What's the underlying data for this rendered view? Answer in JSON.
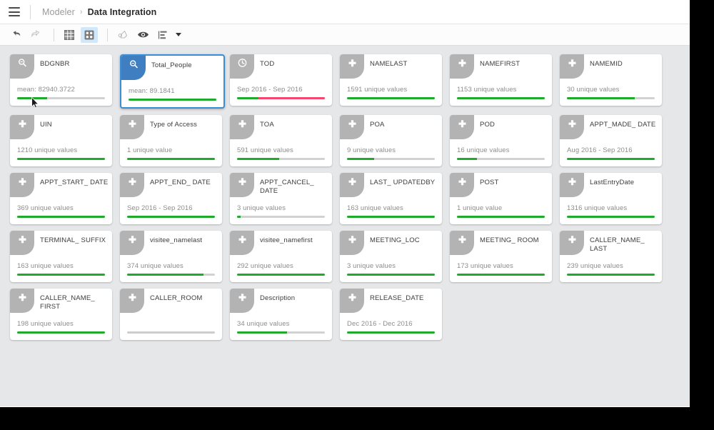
{
  "header": {
    "menu_icon": "hamburger-menu-icon",
    "breadcrumb": {
      "root": "Modeler",
      "separator": "›",
      "current": "Data Integration"
    }
  },
  "toolbar": {
    "buttons": [
      {
        "name": "undo-button",
        "icon": "undo-arrow-icon",
        "label": "Undo",
        "active": false
      },
      {
        "name": "redo-button",
        "icon": "redo-arrow-icon",
        "label": "Redo",
        "active": false
      },
      {
        "name": "table-view-button",
        "icon": "table-grid-icon",
        "label": "Table view",
        "active": false
      },
      {
        "name": "card-view-button",
        "icon": "card-grid-icon",
        "label": "Card view",
        "active": true
      },
      {
        "name": "paint-button",
        "icon": "paint-roller-icon",
        "label": "Paint",
        "active": false
      },
      {
        "name": "preview-button",
        "icon": "eye-icon",
        "label": "Preview",
        "active": false
      },
      {
        "name": "sort-button",
        "icon": "sort-list-icon",
        "label": "Sort",
        "active": false
      }
    ],
    "dropdown_caret": "chevron-down-icon"
  },
  "canvas": {
    "cards": [
      {
        "title": "BDGNBR",
        "type": "continuous",
        "icon": "ruler-icon",
        "stat": "mean: 82940.3722",
        "bar": [
          {
            "color": "#1faa2b",
            "pct": 34
          }
        ],
        "selected": false
      },
      {
        "title": "Total_People",
        "type": "continuous",
        "icon": "ruler-icon",
        "stat": "mean: 89.1841",
        "bar": [
          {
            "color": "#1faa2b",
            "pct": 100
          }
        ],
        "selected": true
      },
      {
        "title": "TOD",
        "type": "datetime",
        "icon": "clock-icon",
        "stat": "Sep 2016 - Sep 2016",
        "bar": [
          {
            "color": "#1faa2b",
            "pct": 24
          },
          {
            "color": "#f3486e",
            "pct": 76
          }
        ],
        "selected": false
      },
      {
        "title": "NAMELAST",
        "type": "categorical",
        "icon": "plus-icon",
        "stat": "1591 unique values",
        "bar": [
          {
            "color": "#1faa2b",
            "pct": 100
          }
        ],
        "selected": false
      },
      {
        "title": "NAMEFIRST",
        "type": "categorical",
        "icon": "plus-icon",
        "stat": "1153 unique values",
        "bar": [
          {
            "color": "#1faa2b",
            "pct": 100
          }
        ],
        "selected": false
      },
      {
        "title": "NAMEMID",
        "type": "categorical",
        "icon": "plus-icon",
        "stat": "30 unique values",
        "bar": [
          {
            "color": "#1faa2b",
            "pct": 77
          }
        ],
        "selected": false
      },
      {
        "title": "UIN",
        "type": "categorical",
        "icon": "plus-icon",
        "stat": "1210 unique values",
        "bar": [
          {
            "color": "#1faa2b",
            "pct": 100
          }
        ],
        "selected": false
      },
      {
        "title": "Type of Access",
        "type": "categorical",
        "icon": "plus-icon",
        "stat": "1 unique value",
        "bar": [
          {
            "color": "#1faa2b",
            "pct": 100
          }
        ],
        "selected": false
      },
      {
        "title": "TOA",
        "type": "categorical",
        "icon": "plus-icon",
        "stat": "591 unique values",
        "bar": [
          {
            "color": "#1faa2b",
            "pct": 48
          }
        ],
        "selected": false
      },
      {
        "title": "POA",
        "type": "categorical",
        "icon": "plus-icon",
        "stat": "9 unique values",
        "bar": [
          {
            "color": "#1faa2b",
            "pct": 31
          }
        ],
        "selected": false
      },
      {
        "title": "POD",
        "type": "categorical",
        "icon": "plus-icon",
        "stat": "16 unique values",
        "bar": [
          {
            "color": "#1faa2b",
            "pct": 23
          }
        ],
        "selected": false
      },
      {
        "title": "APPT_MADE_ DATE",
        "type": "categorical",
        "icon": "plus-icon",
        "stat": "Aug 2016 - Sep 2016",
        "bar": [
          {
            "color": "#1faa2b",
            "pct": 100
          }
        ],
        "selected": false
      },
      {
        "title": "APPT_START_ DATE",
        "type": "categorical",
        "icon": "plus-icon",
        "stat": "369 unique values",
        "bar": [
          {
            "color": "#1faa2b",
            "pct": 100
          }
        ],
        "selected": false
      },
      {
        "title": "APPT_END_ DATE",
        "type": "categorical",
        "icon": "plus-icon",
        "stat": "Sep 2016 - Sep 2016",
        "bar": [
          {
            "color": "#1faa2b",
            "pct": 100
          }
        ],
        "selected": false
      },
      {
        "title": "APPT_CANCEL_ DATE",
        "type": "categorical",
        "icon": "plus-icon",
        "stat": "3 unique values",
        "bar": [
          {
            "color": "#1faa2b",
            "pct": 4
          }
        ],
        "selected": false
      },
      {
        "title": "LAST_ UPDATEDBY",
        "type": "categorical",
        "icon": "plus-icon",
        "stat": "163 unique values",
        "bar": [
          {
            "color": "#1faa2b",
            "pct": 100
          }
        ],
        "selected": false
      },
      {
        "title": "POST",
        "type": "categorical",
        "icon": "plus-icon",
        "stat": "1 unique value",
        "bar": [
          {
            "color": "#1faa2b",
            "pct": 100
          }
        ],
        "selected": false
      },
      {
        "title": "LastEntryDate",
        "type": "categorical",
        "icon": "plus-icon",
        "stat": "1316 unique values",
        "bar": [
          {
            "color": "#1faa2b",
            "pct": 100
          }
        ],
        "selected": false
      },
      {
        "title": "TERMINAL_ SUFFIX",
        "type": "categorical",
        "icon": "plus-icon",
        "stat": "163 unique values",
        "bar": [
          {
            "color": "#1faa2b",
            "pct": 100
          }
        ],
        "selected": false
      },
      {
        "title": "visitee_namelast",
        "type": "categorical",
        "icon": "plus-icon",
        "stat": "374 unique values",
        "bar": [
          {
            "color": "#1faa2b",
            "pct": 87
          }
        ],
        "selected": false
      },
      {
        "title": "visitee_namefirst",
        "type": "categorical",
        "icon": "plus-icon",
        "stat": "292 unique values",
        "bar": [
          {
            "color": "#1faa2b",
            "pct": 100
          }
        ],
        "selected": false
      },
      {
        "title": "MEETING_LOC",
        "type": "categorical",
        "icon": "plus-icon",
        "stat": "3 unique values",
        "bar": [
          {
            "color": "#1faa2b",
            "pct": 100
          }
        ],
        "selected": false
      },
      {
        "title": "MEETING_ ROOM",
        "type": "categorical",
        "icon": "plus-icon",
        "stat": "173 unique values",
        "bar": [
          {
            "color": "#1faa2b",
            "pct": 100
          }
        ],
        "selected": false
      },
      {
        "title": "CALLER_NAME_ LAST",
        "type": "categorical",
        "icon": "plus-icon",
        "stat": "239 unique values",
        "bar": [
          {
            "color": "#1faa2b",
            "pct": 100
          }
        ],
        "selected": false
      },
      {
        "title": "CALLER_NAME_ FIRST",
        "type": "categorical",
        "icon": "plus-icon",
        "stat": "198 unique values",
        "bar": [
          {
            "color": "#1faa2b",
            "pct": 100
          }
        ],
        "selected": false
      },
      {
        "title": "CALLER_ROOM",
        "type": "categorical",
        "icon": "plus-icon",
        "stat": "",
        "bar": [],
        "selected": false
      },
      {
        "title": "Description",
        "type": "categorical",
        "icon": "plus-icon",
        "stat": "34 unique values",
        "bar": [
          {
            "color": "#1faa2b",
            "pct": 57
          }
        ],
        "selected": false
      },
      {
        "title": "RELEASE_DATE",
        "type": "categorical",
        "icon": "plus-icon",
        "stat": "Dec 2016 - Dec 2016",
        "bar": [
          {
            "color": "#1faa2b",
            "pct": 100
          }
        ],
        "selected": false
      }
    ]
  },
  "colors": {
    "accent": "#3a8fd4",
    "bar_green": "#1faa2b",
    "bar_red": "#f3486e",
    "canvas_bg": "#e6e7e9",
    "ribbon_grey": "#b3b3b3",
    "ribbon_blue": "#3f7fc1"
  }
}
